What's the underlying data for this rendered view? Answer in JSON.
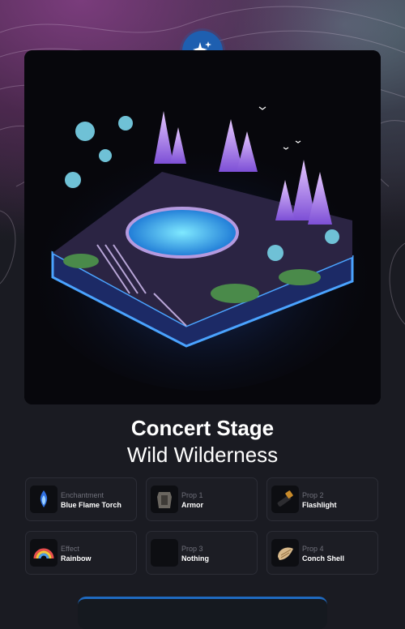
{
  "header": {
    "badge_icon": "sparkles-icon"
  },
  "item": {
    "title": "Concert Stage",
    "subtitle": "Wild Wilderness",
    "image_icon": "concert-stage-island-image"
  },
  "slots": [
    {
      "label": "Enchantment",
      "value": "Blue Flame Torch",
      "icon": "blue-flame-torch-icon"
    },
    {
      "label": "Prop 1",
      "value": "Armor",
      "icon": "armor-icon"
    },
    {
      "label": "Prop 2",
      "value": "Flashlight",
      "icon": "flashlight-icon"
    },
    {
      "label": "Effect",
      "value": "Rainbow",
      "icon": "rainbow-icon"
    },
    {
      "label": "Prop 3",
      "value": "Nothing",
      "icon": "empty-icon"
    },
    {
      "label": "Prop 4",
      "value": "Conch Shell",
      "icon": "conch-shell-icon"
    }
  ],
  "colors": {
    "accent": "#1e5fb0",
    "background": "#1a1b22",
    "glow": "#3a8cff"
  }
}
